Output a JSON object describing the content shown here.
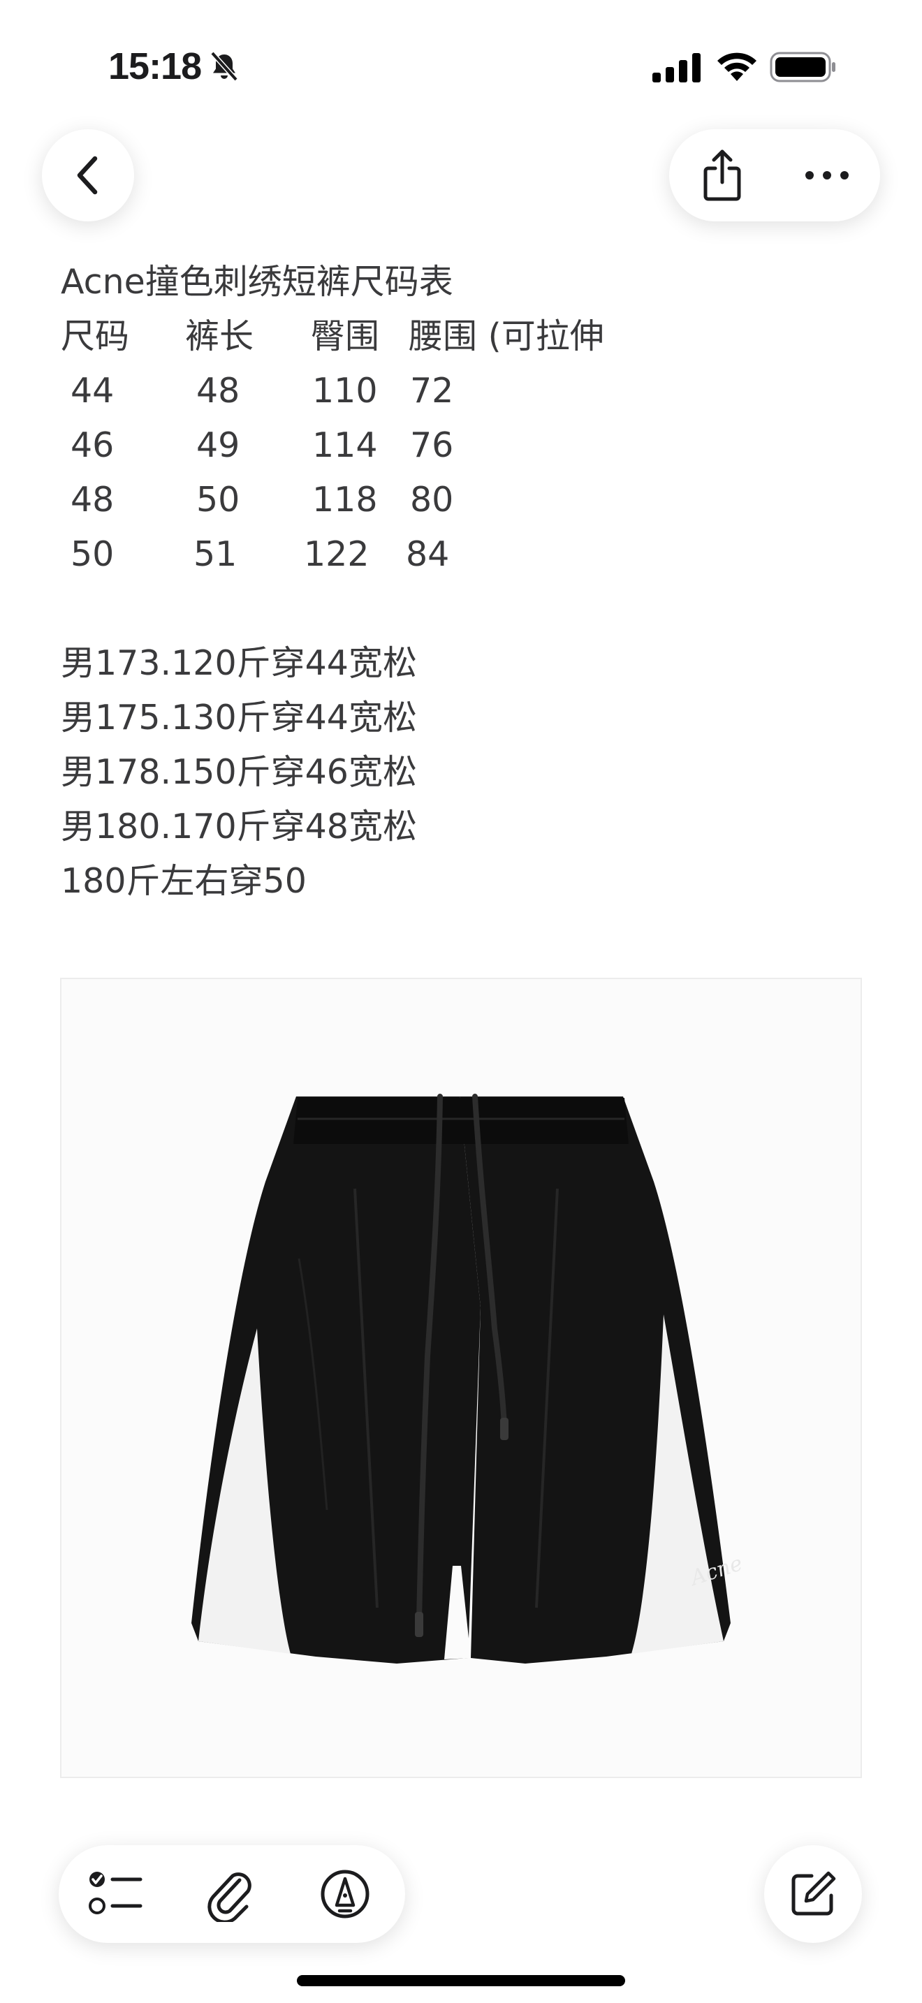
{
  "status_bar": {
    "time": "15:18",
    "icons": [
      "bell-slash-icon",
      "cellular-signal-icon",
      "wifi-icon",
      "battery-icon"
    ]
  },
  "nav": {
    "back_icon": "chevron-left-icon",
    "share_icon": "share-icon",
    "more_icon": "ellipsis-icon"
  },
  "note": {
    "title": "Acne撞色刺绣短裤尺码表",
    "table": {
      "headers": [
        "尺码",
        "裤长",
        "臀围",
        "腰围 (可拉伸"
      ],
      "rows": [
        [
          "44",
          "48",
          "110",
          "72"
        ],
        [
          "46",
          "49",
          "114",
          "76"
        ],
        [
          "48",
          "50",
          "118",
          "80"
        ],
        [
          "50",
          "51",
          "122",
          "84"
        ]
      ]
    },
    "recommendations": [
      "男173.120斤穿44宽松",
      "男175.130斤穿44宽松",
      "男178.150斤穿46宽松",
      "男180.170斤穿48宽松",
      "180斤左右穿50"
    ]
  },
  "image": {
    "subject": "black shorts with white side panels",
    "colors": {
      "body": "#141414",
      "panel": "#f2f2f2",
      "background": "#fbfbfb"
    }
  },
  "toolbar": {
    "icons": [
      "checklist-icon",
      "paperclip-icon",
      "markup-pen-icon",
      "compose-icon"
    ]
  }
}
